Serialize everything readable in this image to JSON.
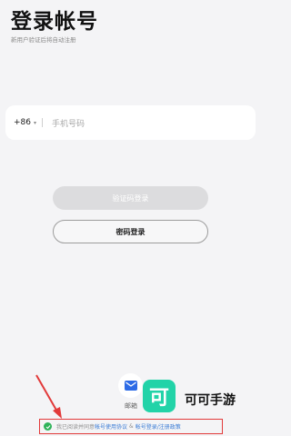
{
  "header": {
    "title": "登录帐号",
    "subtitle": "新用户验证后将自动注册"
  },
  "phone": {
    "country_code": "+86",
    "placeholder": "手机号码"
  },
  "buttons": {
    "code_login": "验证码登录",
    "password_login": "密码登录"
  },
  "other_login": {
    "email_label": "邮箱"
  },
  "watermark": {
    "logo_char": "可",
    "text": "可可手游"
  },
  "agreement": {
    "prefix": "我已阅读并同意",
    "link1": "帐号使用协议",
    "and": "&",
    "link2": "帐号登录/注册政策"
  },
  "colors": {
    "background": "#f4f4f6",
    "link": "#3a7bd5",
    "check": "#2fb35a",
    "highlight": "#e23a3a",
    "mail": "#2d6be6",
    "watermark": "#22d3a8"
  }
}
